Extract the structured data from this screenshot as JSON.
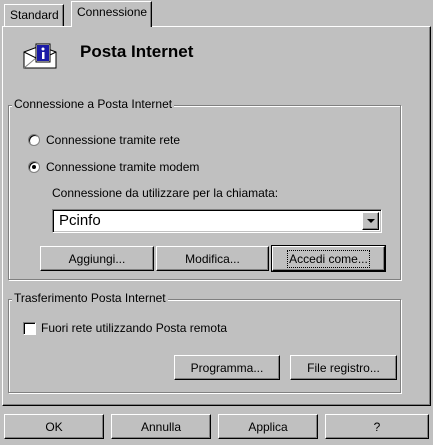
{
  "tabs": [
    "Standard",
    "Connessione"
  ],
  "header": {
    "title": "Posta Internet",
    "icon": "mail-envelope-icon"
  },
  "connection_group": {
    "legend": "Connessione a Posta Internet",
    "radio_network": "Connessione tramite rete",
    "radio_modem": "Connessione tramite modem",
    "selected": "modem",
    "dial_label": "Connessione da utilizzare per la chiamata:",
    "dial_value": "Pcinfo",
    "buttons": {
      "add": "Aggiungi...",
      "edit": "Modifica...",
      "login": "Accedi come..."
    }
  },
  "transfer_group": {
    "legend": "Trasferimento Posta Internet",
    "offline_label": "Fuori rete utilizzando Posta remota",
    "offline_checked": false,
    "buttons": {
      "schedule": "Programma...",
      "log": "File registro..."
    }
  },
  "footer": {
    "ok": "OK",
    "cancel": "Annulla",
    "apply": "Applica",
    "help": "?"
  }
}
